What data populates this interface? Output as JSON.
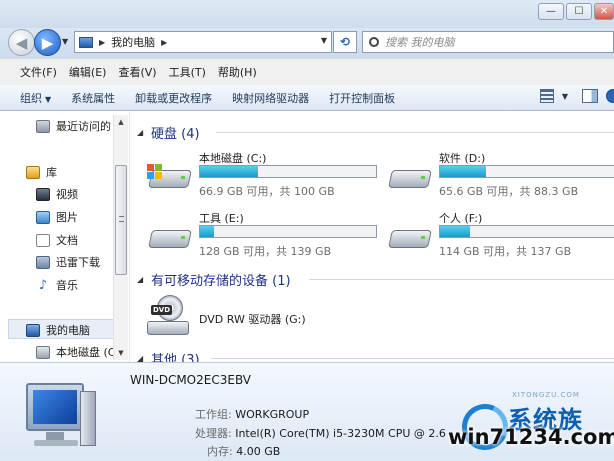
{
  "window": {
    "minimize_glyph": "—",
    "maximize_glyph": "☐",
    "close_glyph": "✕"
  },
  "address": {
    "location": "我的电脑",
    "search_placeholder": "搜索 我的电脑"
  },
  "menu": [
    "文件(F)",
    "编辑(E)",
    "查看(V)",
    "工具(T)",
    "帮助(H)"
  ],
  "toolbar": {
    "organize": "组织",
    "system_properties": "系统属性",
    "uninstall": "卸载或更改程序",
    "map_drive": "映射网络驱动器",
    "control_panel": "打开控制面板"
  },
  "nav": {
    "recent": "最近访问的",
    "libraries": "库",
    "videos": "视频",
    "pictures": "图片",
    "documents": "文档",
    "thunder": "迅雷下载",
    "music": "音乐",
    "computer": "我的电脑",
    "local_disk": "本地磁盘 (C"
  },
  "groups": {
    "hdd": "硬盘 (4)",
    "removable": "有可移动存储的设备 (1)",
    "other": "其他 (3)"
  },
  "drives": [
    {
      "name": "本地磁盘 (C:)",
      "space": "66.9 GB 可用，共 100 GB",
      "used_fraction": 0.33
    },
    {
      "name": "软件 (D:)",
      "space": "65.6 GB 可用，共 88.3 GB",
      "used_fraction": 0.26
    },
    {
      "name": "工具 (E:)",
      "space": "128 GB 可用，共 139 GB",
      "used_fraction": 0.08
    },
    {
      "name": "个人 (F:)",
      "space": "114 GB 可用，共 137 GB",
      "used_fraction": 0.17
    }
  ],
  "dvd": {
    "badge": "DVD",
    "name": "DVD RW 驱动器 (G:)"
  },
  "details": {
    "computer_name": "WIN-DCMO2EC3EBV",
    "workgroup_label": "工作组:",
    "workgroup": "WORKGROUP",
    "processor_label": "处理器:",
    "processor": "Intel(R) Core(TM) i5-3230M CPU @ 2.6",
    "memory_label": "内存:",
    "memory": "4.00 GB"
  },
  "watermark": {
    "site": "win71234.com",
    "brand": "系统族",
    "sub": "XITONGZU.COM"
  }
}
